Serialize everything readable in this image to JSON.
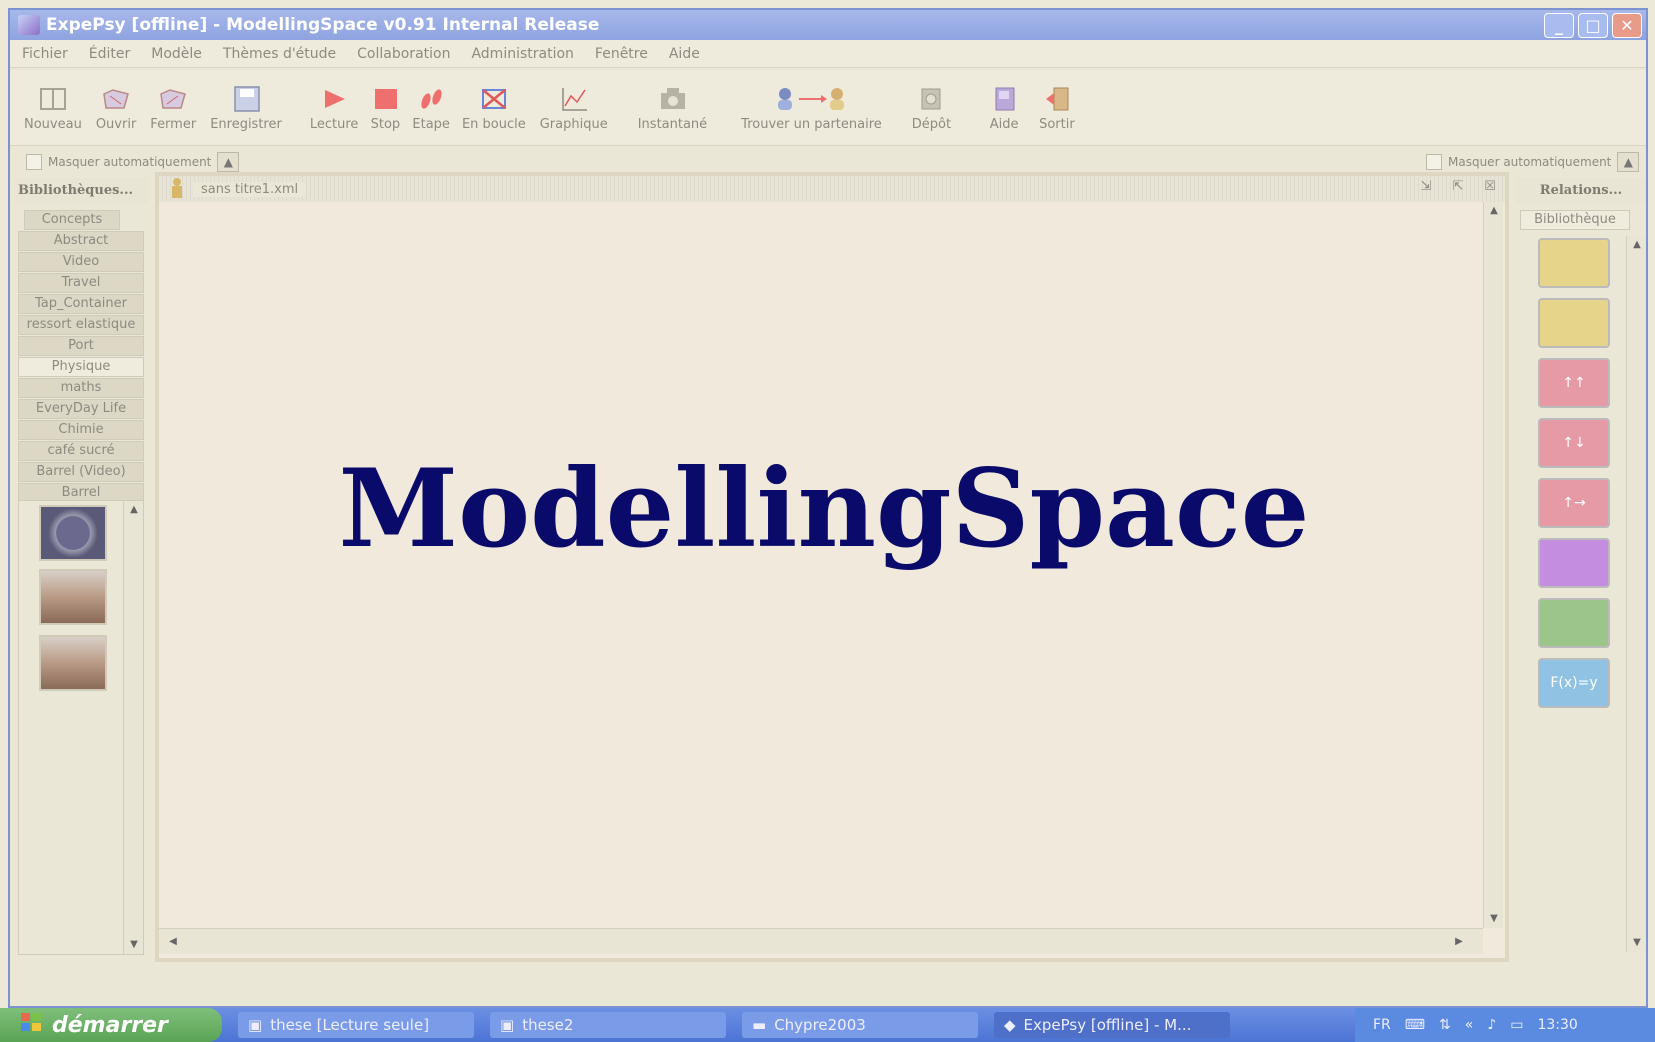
{
  "window": {
    "title": "ExpePsy [offline] - ModellingSpace v0.91 Internal Release"
  },
  "menu": [
    "Fichier",
    "Éditer",
    "Modèle",
    "Thèmes d'étude",
    "Collaboration",
    "Administration",
    "Fenêtre",
    "Aide"
  ],
  "toolbar": {
    "nouveau": "Nouveau",
    "ouvrir": "Ouvrir",
    "fermer": "Fermer",
    "enregistrer": "Enregistrer",
    "lecture": "Lecture",
    "stop": "Stop",
    "etape": "Etape",
    "en_boucle": "En boucle",
    "graphique": "Graphique",
    "instantane": "Instantané",
    "trouver": "Trouver un partenaire",
    "depot": "Dépôt",
    "aide": "Aide",
    "sortir": "Sortir"
  },
  "autohide": {
    "left": "Masquer automatiquement",
    "right": "Masquer automatiquement"
  },
  "left_panel": {
    "title": "Bibliothèques...",
    "tabs": [
      "Concepts",
      "Abstract",
      "Video",
      "Travel",
      "Tap_Container",
      "ressort elastique",
      "Port",
      "Physique",
      "maths",
      "EveryDay Life",
      "Chimie",
      "café sucré",
      "Barrel (Video)",
      "Barrel"
    ],
    "selected_tab": "Physique"
  },
  "document": {
    "title": "sans titre1.xml",
    "watermark": "ModellingSpace"
  },
  "right_panel": {
    "title": "Relations...",
    "tab": "Bibliothèque",
    "buttons": [
      {
        "icon": "cup-icon",
        "color": "#e6d48a",
        "text": ""
      },
      {
        "icon": "cup-list-icon",
        "color": "#e6d48a",
        "text": ""
      },
      {
        "icon": "up-up-arrows-icon",
        "color": "#e59aa6",
        "text": "↑↑"
      },
      {
        "icon": "up-down-arrows-icon",
        "color": "#e59aa6",
        "text": "↑↓"
      },
      {
        "icon": "up-right-arrows-icon",
        "color": "#e59aa6",
        "text": "↑→"
      },
      {
        "icon": "graph-curve-icon",
        "color": "#c58de0",
        "text": ""
      },
      {
        "icon": "table-icon",
        "color": "#9cc58a",
        "text": ""
      },
      {
        "icon": "function-icon",
        "color": "#8fc2e3",
        "text": "F(x)=y"
      }
    ]
  },
  "taskbar": {
    "start": "démarrer",
    "items": [
      "these [Lecture seule]",
      "these2",
      "Chypre2003",
      "ExpePsy [offline] - M..."
    ],
    "lang": "FR",
    "time": "13:30"
  }
}
